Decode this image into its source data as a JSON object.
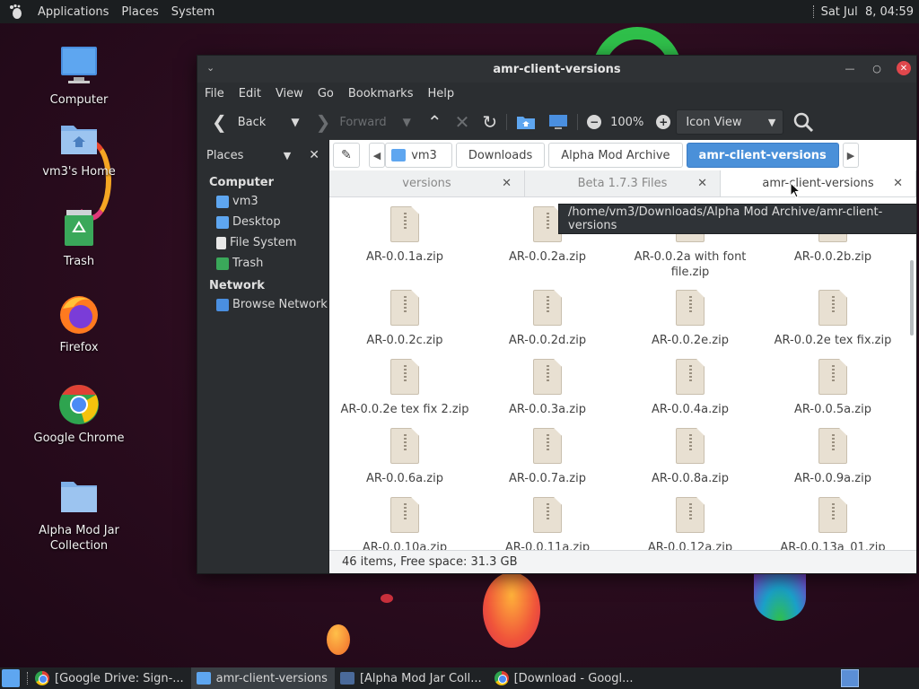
{
  "top_panel": {
    "menus": [
      "Applications",
      "Places",
      "System"
    ],
    "clock": "Sat Jul  8, 04:59"
  },
  "desktop": {
    "icons": [
      {
        "label": "Computer",
        "icon": "monitor-icon"
      },
      {
        "label": "vm3's Home",
        "icon": "home-folder-icon"
      },
      {
        "label": "Trash",
        "icon": "trash-icon"
      },
      {
        "label": "Firefox",
        "icon": "firefox-icon"
      },
      {
        "label": "Google Chrome",
        "icon": "chrome-icon"
      },
      {
        "label": "Alpha Mod Jar Collection",
        "icon": "folder-icon"
      }
    ]
  },
  "window": {
    "title": "amr-client-versions",
    "menubar": [
      "File",
      "Edit",
      "View",
      "Go",
      "Bookmarks",
      "Help"
    ],
    "toolbar": {
      "back": "Back",
      "forward": "Forward",
      "zoom": "100%",
      "view_mode": "Icon View"
    },
    "sidebar": {
      "header": "Places",
      "sections": [
        {
          "title": "Computer",
          "items": [
            "vm3",
            "Desktop",
            "File System",
            "Trash"
          ]
        },
        {
          "title": "Network",
          "items": [
            "Browse Network"
          ]
        }
      ]
    },
    "pathbar": [
      "vm3",
      "Downloads",
      "Alpha Mod Archive",
      "amr-client-versions"
    ],
    "tabs": [
      {
        "label": "versions",
        "active": false
      },
      {
        "label": "Beta 1.7.3 Files",
        "active": false
      },
      {
        "label": "amr-client-versions",
        "active": true
      }
    ],
    "tooltip": "/home/vm3/Downloads/Alpha Mod Archive/amr-client-versions",
    "files": [
      "AR-0.0.1a.zip",
      "AR-0.0.2a.zip",
      "AR-0.0.2a with font file.zip",
      "AR-0.0.2b.zip",
      "AR-0.0.2c.zip",
      "AR-0.0.2d.zip",
      "AR-0.0.2e.zip",
      "AR-0.0.2e tex fix.zip",
      "AR-0.0.2e tex fix 2.zip",
      "AR-0.0.3a.zip",
      "AR-0.0.4a.zip",
      "AR-0.0.5a.zip",
      "AR-0.0.6a.zip",
      "AR-0.0.7a.zip",
      "AR-0.0.8a.zip",
      "AR-0.0.9a.zip",
      "AR-0.0.10a.zip",
      "AR-0.0.11a.zip",
      "AR-0.0.12a.zip",
      "AR-0.0.13a_01.zip"
    ],
    "status": "46 items, Free space: 31.3 GB"
  },
  "taskbar": {
    "tasks": [
      {
        "label": "[Google Drive: Sign-...",
        "icon": "chrome-icon",
        "active": false
      },
      {
        "label": "amr-client-versions",
        "icon": "folder-icon",
        "active": true
      },
      {
        "label": "[Alpha Mod Jar Coll...",
        "icon": "folder-icon",
        "active": false
      },
      {
        "label": "[Download - Googl...",
        "icon": "chrome-icon",
        "active": false
      }
    ]
  },
  "colors": {
    "accent": "#4a90d9",
    "close_button": "#e0474c",
    "panel": "#1b1e20"
  }
}
